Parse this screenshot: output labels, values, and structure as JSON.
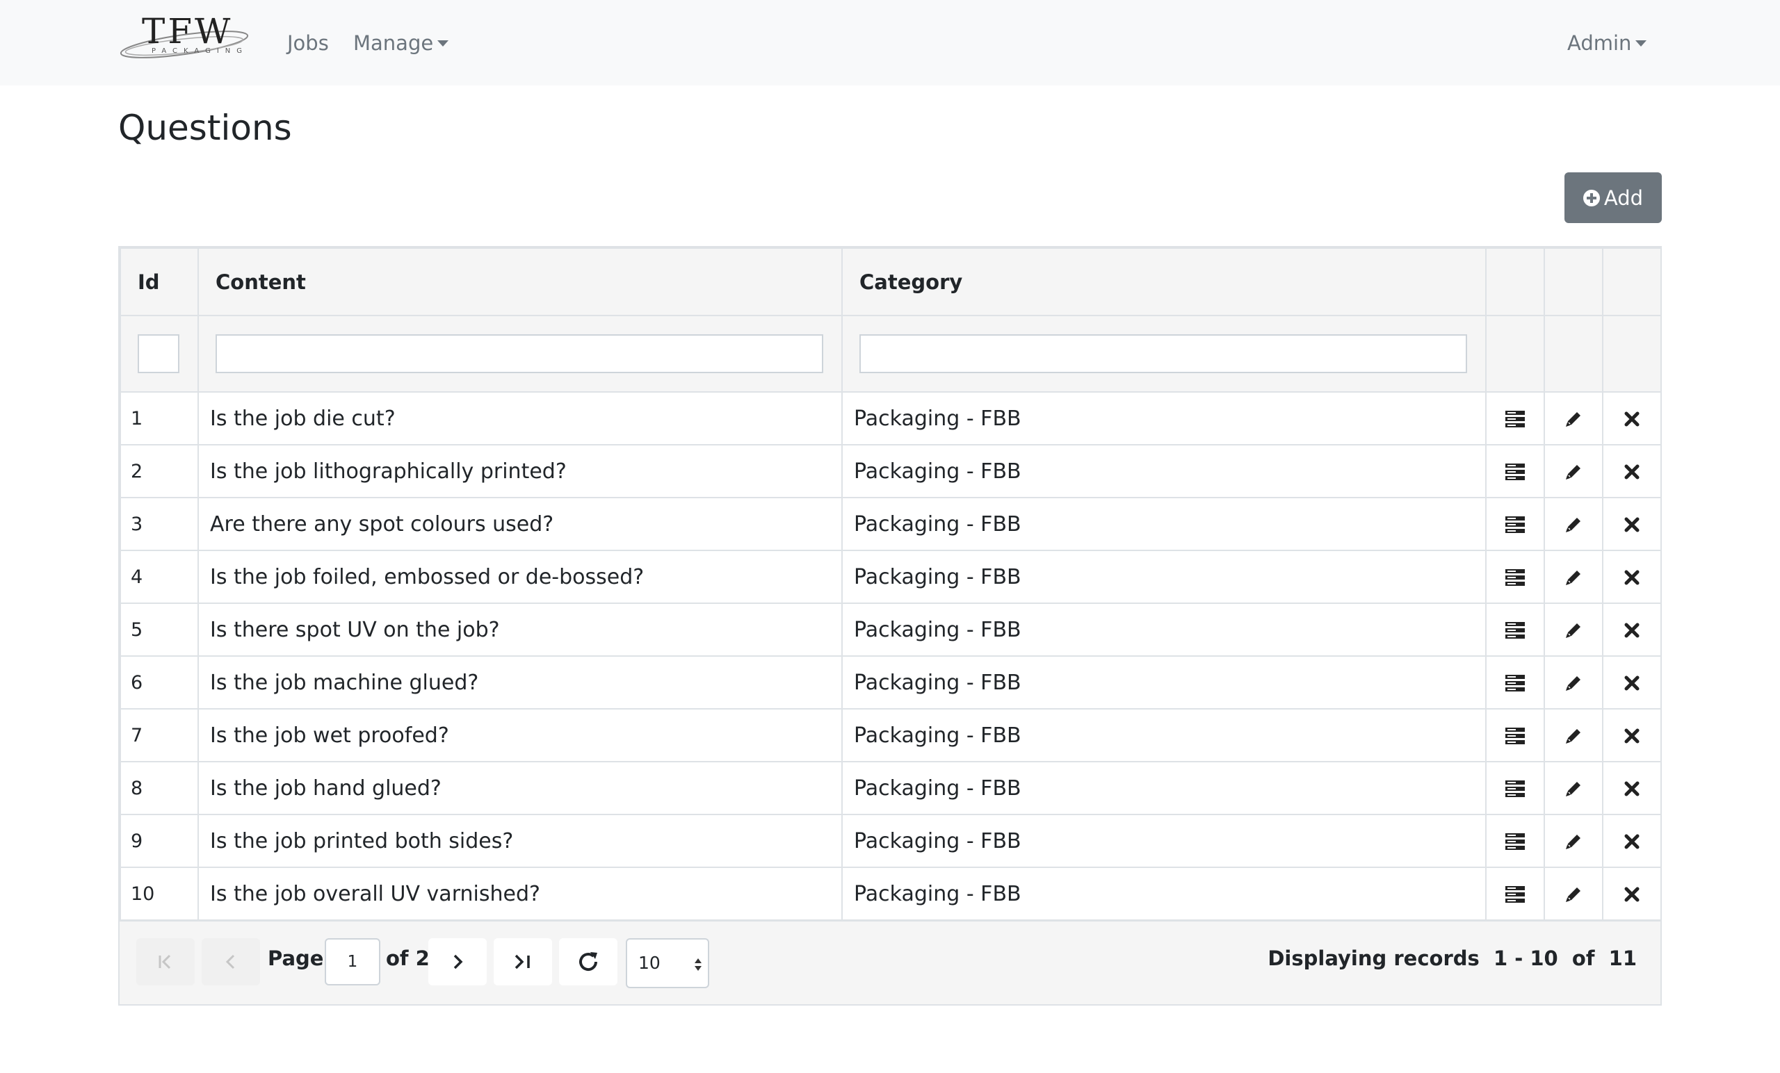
{
  "nav": {
    "logo_text": "TFW",
    "logo_sub": "PACKAGING",
    "jobs": "Jobs",
    "manage": "Manage",
    "admin": "Admin"
  },
  "page": {
    "title": "Questions",
    "add_label": "Add"
  },
  "grid": {
    "columns": {
      "id": "Id",
      "content": "Content",
      "category": "Category"
    },
    "rows": [
      {
        "id": "1",
        "content": "Is the job die cut?",
        "category": "Packaging - FBB"
      },
      {
        "id": "2",
        "content": "Is the job lithographically printed?",
        "category": "Packaging - FBB"
      },
      {
        "id": "3",
        "content": "Are there any spot colours used?",
        "category": "Packaging - FBB"
      },
      {
        "id": "4",
        "content": "Is the job foiled, embossed or de-bossed?",
        "category": "Packaging - FBB"
      },
      {
        "id": "5",
        "content": "Is there spot UV on the job?",
        "category": "Packaging - FBB"
      },
      {
        "id": "6",
        "content": "Is the job machine glued?",
        "category": "Packaging - FBB"
      },
      {
        "id": "7",
        "content": "Is the job wet proofed?",
        "category": "Packaging - FBB"
      },
      {
        "id": "8",
        "content": "Is the job hand glued?",
        "category": "Packaging - FBB"
      },
      {
        "id": "9",
        "content": "Is the job printed both sides?",
        "category": "Packaging - FBB"
      },
      {
        "id": "10",
        "content": "Is the job overall UV varnished?",
        "category": "Packaging - FBB"
      }
    ],
    "row_icons": [
      "details-icon",
      "edit-pencil-icon",
      "delete-x-icon"
    ]
  },
  "pager": {
    "page_label": "Page",
    "current_page": "1",
    "of_label": "of 2",
    "page_size": "10",
    "records_text": "Displaying records  1 - 10  of  11"
  },
  "colors": {
    "navbar_bg": "#f8f9fa",
    "button_secondary": "#6c757d",
    "grid_header_bg": "#f5f5f5",
    "border": "#dee2e6"
  }
}
